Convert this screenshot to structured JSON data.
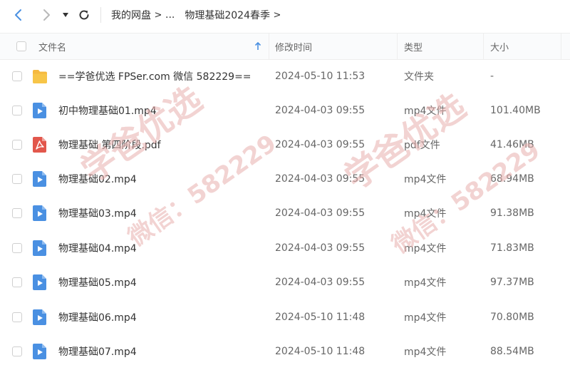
{
  "toolbar": {
    "back_icon": "chevron-left-icon",
    "forward_icon": "chevron-right-icon",
    "dropdown_icon": "caret-down-icon",
    "refresh_icon": "refresh-icon",
    "breadcrumbs": [
      "我的网盘",
      "...",
      "物理基础2024春季"
    ]
  },
  "columns": {
    "name": "文件名",
    "modified": "修改时间",
    "type": "类型",
    "size": "大小"
  },
  "colors": {
    "accent": "#4a90e2",
    "folder": "#f7c548",
    "video": "#4a90e2",
    "pdf": "#e2574c"
  },
  "files": [
    {
      "name": "==学爸优选 FPSer.com 微信 582229==",
      "modified": "2024-05-10 11:53",
      "type": "文件夹",
      "size": "-",
      "icon": "folder-icon"
    },
    {
      "name": "初中物理基础01.mp4",
      "modified": "2024-04-03 09:55",
      "type": "mp4文件",
      "size": "101.40MB",
      "icon": "video-file-icon"
    },
    {
      "name": "物理基础 第四阶段.pdf",
      "modified": "2024-04-03 09:55",
      "type": "pdf文件",
      "size": "41.46MB",
      "icon": "pdf-file-icon"
    },
    {
      "name": "物理基础02.mp4",
      "modified": "2024-04-03 09:55",
      "type": "mp4文件",
      "size": "68.94MB",
      "icon": "video-file-icon"
    },
    {
      "name": "物理基础03.mp4",
      "modified": "2024-04-03 09:55",
      "type": "mp4文件",
      "size": "91.38MB",
      "icon": "video-file-icon"
    },
    {
      "name": "物理基础04.mp4",
      "modified": "2024-04-03 09:55",
      "type": "mp4文件",
      "size": "71.83MB",
      "icon": "video-file-icon"
    },
    {
      "name": "物理基础05.mp4",
      "modified": "2024-04-03 09:55",
      "type": "mp4文件",
      "size": "97.37MB",
      "icon": "video-file-icon"
    },
    {
      "name": "物理基础06.mp4",
      "modified": "2024-05-10 11:48",
      "type": "mp4文件",
      "size": "70.80MB",
      "icon": "video-file-icon"
    },
    {
      "name": "物理基础07.mp4",
      "modified": "2024-05-10 11:48",
      "type": "mp4文件",
      "size": "88.54MB",
      "icon": "video-file-icon"
    }
  ],
  "watermark": {
    "lines": [
      "学爸优选",
      "微信：582229"
    ]
  }
}
